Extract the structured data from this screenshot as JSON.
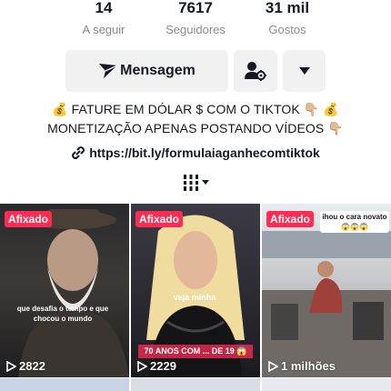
{
  "stats": [
    {
      "value": "14",
      "label": "A seguir"
    },
    {
      "value": "7617",
      "label": "Seguidores"
    },
    {
      "value": "31 mil",
      "label": "Gostos"
    }
  ],
  "actions": {
    "message_label": "Mensagem",
    "message_icon": "send-icon",
    "add_friend_icon": "add-friend-icon",
    "more_icon": "caret-down-icon"
  },
  "bio": {
    "line1": "💰 FATURE EM DÓLAR $ COM O TIKTOK 👇🏼 💰",
    "line2": "MONETIZAÇÃO APENAS POSTANDO VÍDEOS 👇🏼",
    "link": "https://bit.ly/formulaiaganhecomtiktok"
  },
  "tabs": {
    "active_icon": "grid-icon"
  },
  "videos": [
    {
      "badge": "Afixado",
      "views": "2822",
      "caption": "que desafia o tempo e que chocou o mundo"
    },
    {
      "badge": "Afixado",
      "views": "2229",
      "caption_top": "veja minha",
      "caption_bottom": "70 ANOS COM ... DE 19 😱"
    },
    {
      "badge": "Afixado",
      "views": "1 milhões",
      "caption": "ihou o cara novato 😱😱😱"
    }
  ],
  "colors": {
    "accent": "#fe2c55",
    "muted": "#8a8b91",
    "button_bg": "#f1f1f2"
  }
}
